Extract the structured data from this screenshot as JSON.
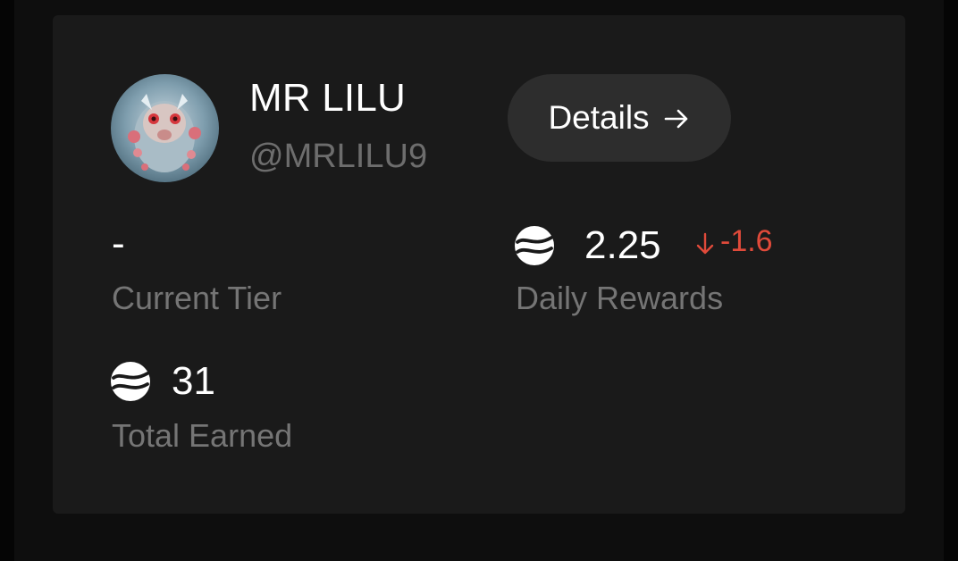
{
  "profile": {
    "display_name": "MR LILU",
    "handle": "@MRLILU9"
  },
  "actions": {
    "details_label": "Details"
  },
  "stats": {
    "tier": {
      "value": "-",
      "label": "Current Tier"
    },
    "daily_rewards": {
      "value": "2.25",
      "delta": "-1.6",
      "label": "Daily Rewards",
      "icon": "token-icon"
    },
    "total_earned": {
      "value": "31",
      "label": "Total Earned",
      "icon": "token-icon"
    }
  },
  "colors": {
    "background": "#050505",
    "card": "#1a1a1a",
    "button": "#2d2d2d",
    "text_primary": "#ffffff",
    "text_secondary": "#757575",
    "negative": "#e04a3a"
  }
}
